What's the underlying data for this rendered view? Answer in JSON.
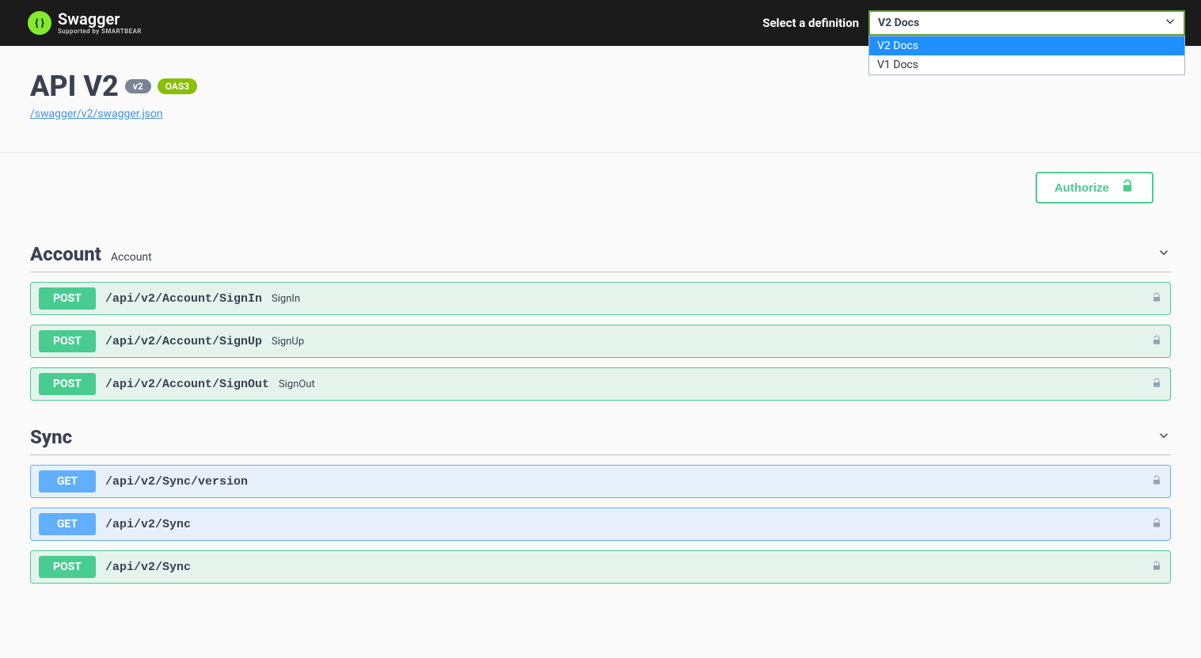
{
  "topbar": {
    "brand": "Swagger",
    "supported_by": "Supported by SMARTBEAR",
    "select_label": "Select a definition",
    "selected": "V2 Docs",
    "options": [
      "V2 Docs",
      "V1 Docs"
    ]
  },
  "info": {
    "title": "API V2",
    "version": "v2",
    "oas": "OAS3",
    "spec_url": "/swagger/v2/swagger.json"
  },
  "auth": {
    "label": "Authorize"
  },
  "tags": [
    {
      "name": "Account",
      "description": "Account",
      "ops": [
        {
          "method": "POST",
          "methodClass": "post",
          "path": "/api/v2/Account/SignIn",
          "summary": "SignIn"
        },
        {
          "method": "POST",
          "methodClass": "post",
          "path": "/api/v2/Account/SignUp",
          "summary": "SignUp"
        },
        {
          "method": "POST",
          "methodClass": "post",
          "path": "/api/v2/Account/SignOut",
          "summary": "SignOut"
        }
      ]
    },
    {
      "name": "Sync",
      "description": "",
      "ops": [
        {
          "method": "GET",
          "methodClass": "get",
          "path": "/api/v2/Sync/version",
          "summary": ""
        },
        {
          "method": "GET",
          "methodClass": "get",
          "path": "/api/v2/Sync",
          "summary": ""
        },
        {
          "method": "POST",
          "methodClass": "post",
          "path": "/api/v2/Sync",
          "summary": ""
        }
      ]
    }
  ]
}
